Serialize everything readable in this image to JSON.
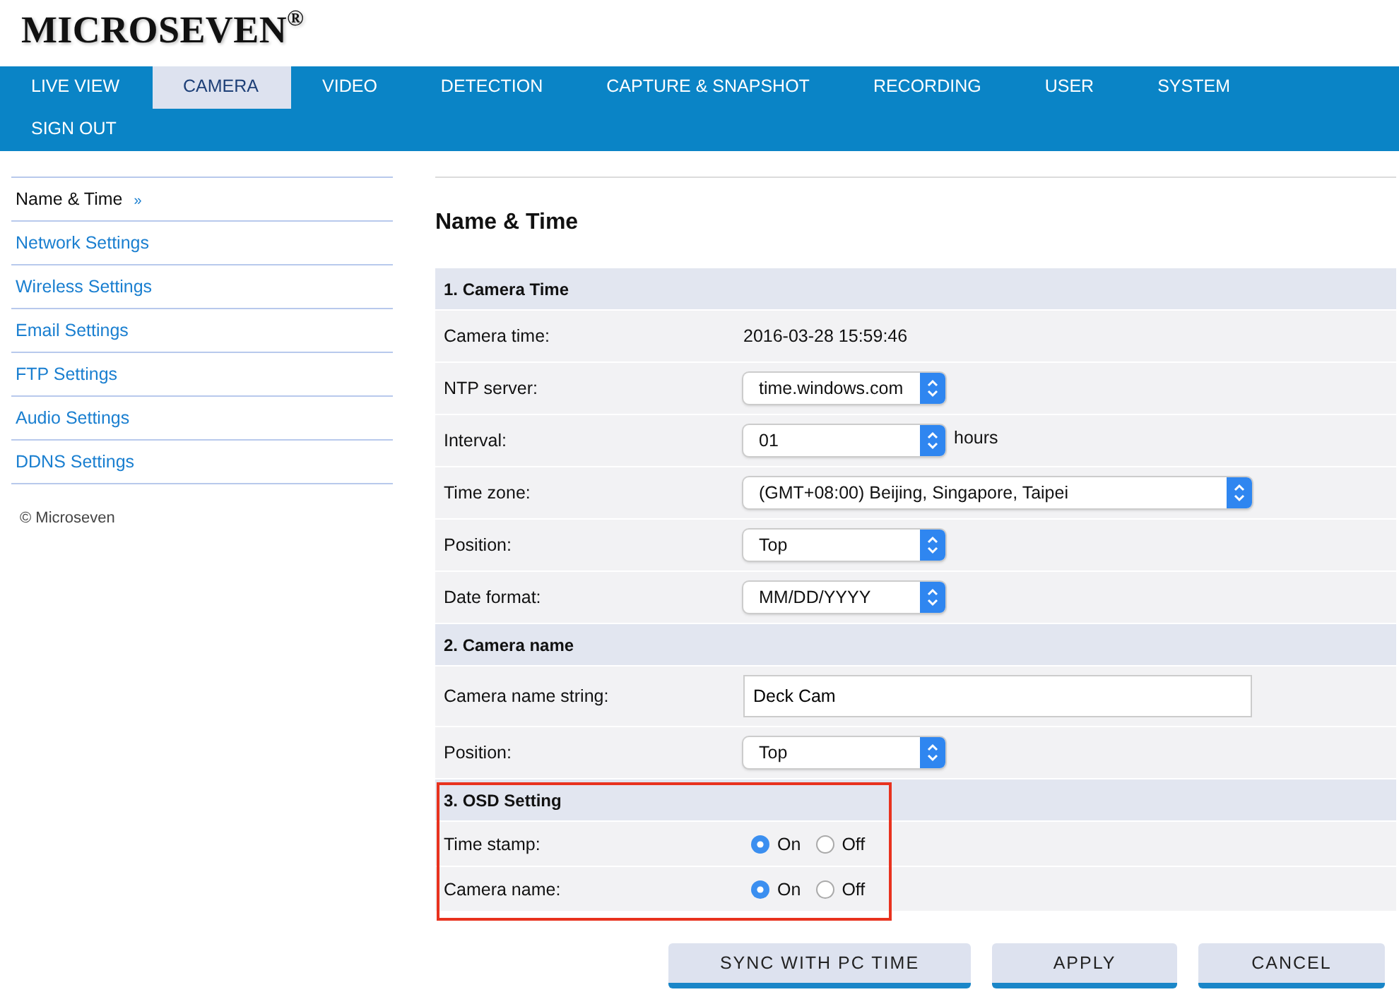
{
  "logo": "MICROSEVEN$^{®}$",
  "nav": [
    {
      "label": "LIVE VIEW",
      "selected": false
    },
    {
      "label": "CAMERA",
      "selected": true
    },
    {
      "label": "VIDEO",
      "selected": false
    },
    {
      "label": "DETECTION",
      "selected": false
    },
    {
      "label": "CAPTURE & SNAPSHOT",
      "selected": false
    },
    {
      "label": "RECORDING",
      "selected": false
    },
    {
      "label": "USER",
      "selected": false
    },
    {
      "label": "SYSTEM",
      "selected": false
    },
    {
      "label": "SIGN OUT",
      "selected": false
    }
  ],
  "sidebar": {
    "items": [
      {
        "label": "Name & Time",
        "marker": "»",
        "selected": true
      },
      {
        "label": "Network Settings",
        "selected": false
      },
      {
        "label": "Wireless Settings",
        "selected": false
      },
      {
        "label": "Email Settings",
        "selected": false
      },
      {
        "label": "FTP Settings",
        "selected": false
      },
      {
        "label": "Audio Settings",
        "selected": false
      },
      {
        "label": "DDNS Settings",
        "selected": false
      }
    ],
    "copyright": "© Microseven"
  },
  "page_title": "Name & Time",
  "sections": [
    {
      "title": "1. Camera Time",
      "highlighted": false,
      "rows": [
        {
          "kind": "text",
          "label": "Camera time:",
          "value": "2016-03-28 15:59:46"
        },
        {
          "kind": "select",
          "label": "NTP server:",
          "value": "time.windows.com"
        },
        {
          "kind": "select",
          "label": "Interval:",
          "value": "01",
          "suffix": "hours"
        },
        {
          "kind": "select",
          "wide": true,
          "label": "Time zone:",
          "value": "(GMT+08:00) Beijing, Singapore, Taipei"
        },
        {
          "kind": "select",
          "label": "Position:",
          "value": "Top"
        },
        {
          "kind": "select",
          "label": "Date format:",
          "value": "MM/DD/YYYY"
        }
      ]
    },
    {
      "title": "2. Camera name",
      "highlighted": false,
      "rows": [
        {
          "kind": "input",
          "label": "Camera name string:",
          "value": "Deck Cam"
        },
        {
          "kind": "select",
          "label": "Position:",
          "value": "Top"
        }
      ]
    },
    {
      "title": "3. OSD Setting",
      "highlighted": true,
      "rows": [
        {
          "kind": "radio",
          "label": "Time stamp:",
          "options": [
            {
              "label": "On",
              "selected": true
            },
            {
              "label": "Off",
              "selected": false
            }
          ]
        },
        {
          "kind": "radio",
          "label": "Camera name:",
          "options": [
            {
              "label": "On",
              "selected": true
            },
            {
              "label": "Off",
              "selected": false
            }
          ]
        }
      ]
    }
  ],
  "buttons": [
    "SYNC WITH PC TIME",
    "APPLY",
    "CANCEL"
  ]
}
